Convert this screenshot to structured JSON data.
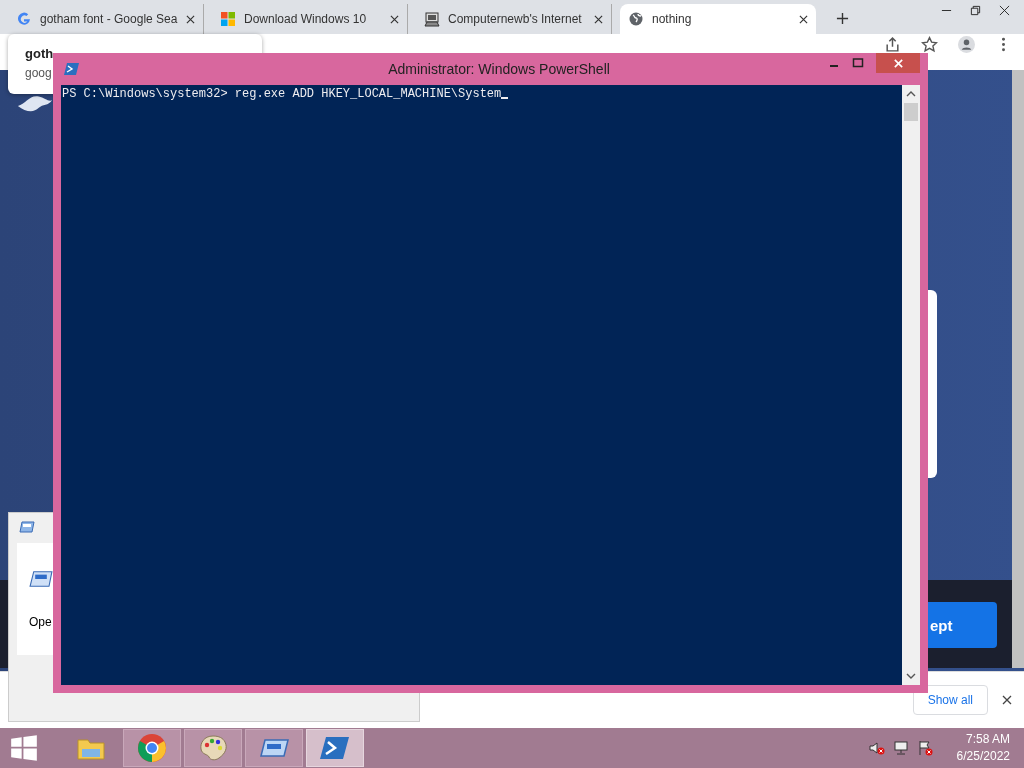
{
  "browser": {
    "tabs": [
      {
        "kind": "g-logo",
        "title": "gotham font - Google Sea",
        "selected": false
      },
      {
        "kind": "windows",
        "title": "Download Windows 10",
        "selected": false
      },
      {
        "kind": "computer",
        "title": "Computernewb's Internet",
        "selected": false
      },
      {
        "kind": "globe",
        "title": "nothing",
        "selected": true
      }
    ],
    "tooltip": {
      "lines": [
        "goth",
        "goog"
      ]
    },
    "page": {
      "button": "ept"
    },
    "download_bar": {
      "show_all": "Show all"
    }
  },
  "dialog": {
    "text": "Ope"
  },
  "powershell": {
    "title": "Administrator: Windows PowerShell",
    "lines": [
      "PS C:\\Windows\\system32> reg.exe ADD HKEY_LOCAL_MACHINE\\System"
    ]
  },
  "taskbar": {
    "apps": [
      {
        "kind": "explorer",
        "running": false,
        "active": false
      },
      {
        "kind": "chrome",
        "running": true,
        "active": false
      },
      {
        "kind": "paint",
        "running": true,
        "active": false
      },
      {
        "kind": "window",
        "running": true,
        "active": false
      },
      {
        "kind": "powershell",
        "running": true,
        "active": true
      }
    ],
    "time": "7:58 AM",
    "date": "6/25/2022"
  }
}
